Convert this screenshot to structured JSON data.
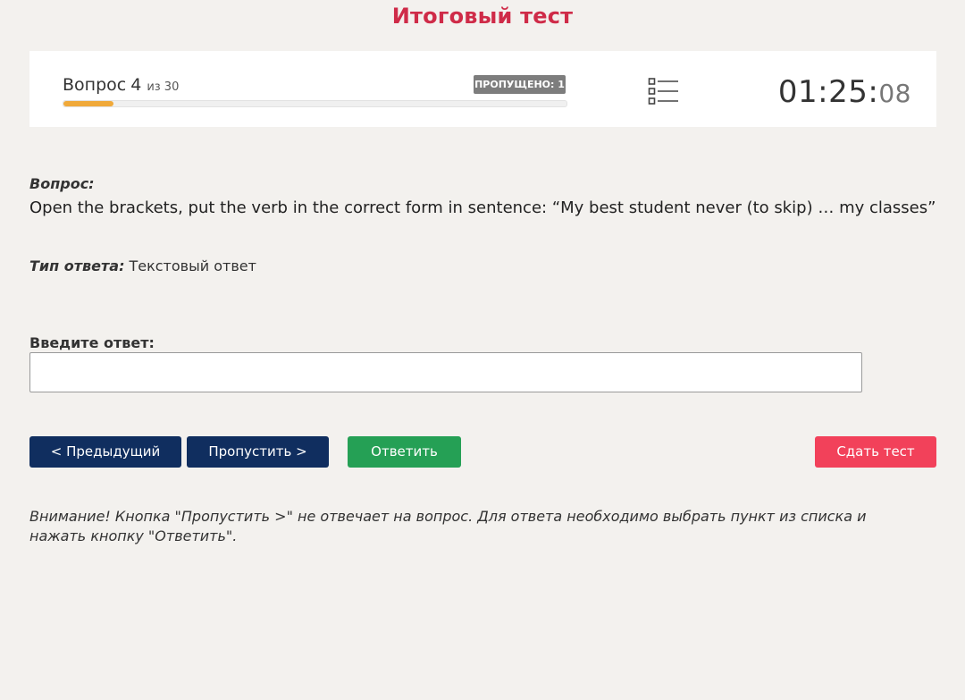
{
  "page_title": "Итоговый тест",
  "status": {
    "question_word": "Вопрос",
    "question_number": "4",
    "question_total": "из 30",
    "progress_percent": 10,
    "skipped_badge": "ПРОПУЩЕНО: 1",
    "list_icon": "list-icon",
    "timer_main": "01:25:",
    "timer_seconds": "08"
  },
  "question": {
    "label": "Вопрос:",
    "text": "Open the brackets, put the verb in the correct form in sentence: “My best student never (to skip) … my classes”"
  },
  "answer_type": {
    "label": "Тип ответа:",
    "value": "Текстовый ответ"
  },
  "answer_input": {
    "label": "Введите ответ:",
    "value": "",
    "placeholder": ""
  },
  "buttons": {
    "prev": "< Предыдущий",
    "skip": "Пропустить >",
    "answer": "Ответить",
    "submit": "Сдать тест"
  },
  "warning": "Внимание! Кнопка \"Пропустить >\" не отвечает на вопрос. Для ответа необходимо выбрать пункт из списка и нажать кнопку \"Ответить\".",
  "colors": {
    "title": "#cf2b48",
    "progress": "#f0a93a",
    "nav_button": "#102e5f",
    "answer_button": "#25a055",
    "submit_button": "#f2415a"
  }
}
